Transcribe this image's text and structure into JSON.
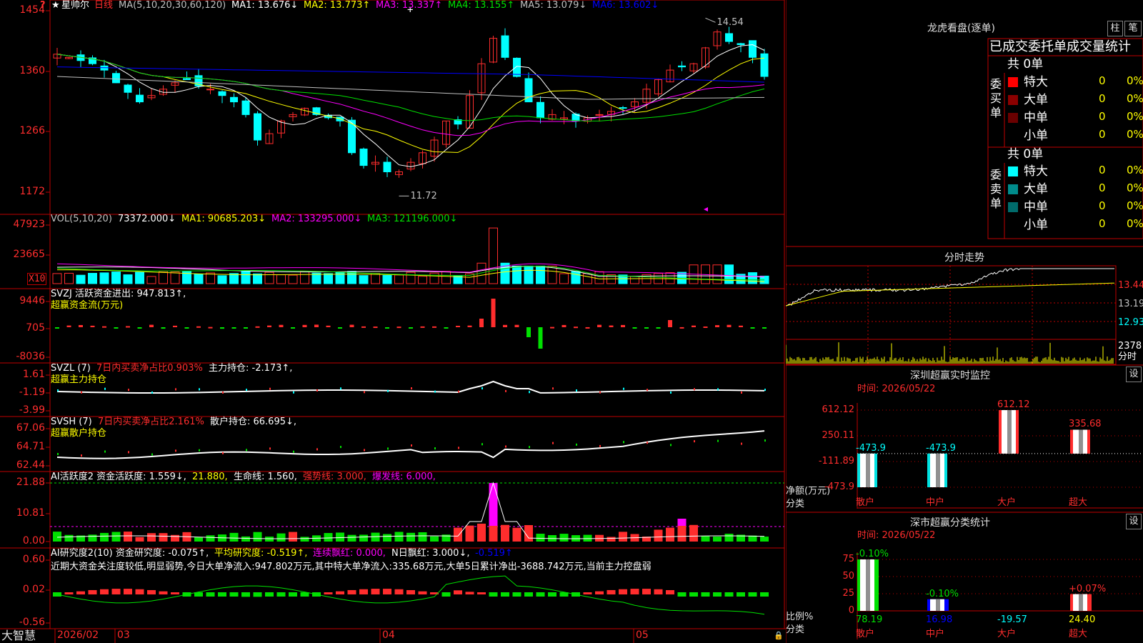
{
  "stock": {
    "name": "星帅尔",
    "period": "日线",
    "corner_mark": "?"
  },
  "colors": {
    "bg": "#000000",
    "frame": "#c00000",
    "up": "#ff2d2d",
    "down": "#00ffff",
    "ma1": "#ffffff",
    "ma2": "#ffff00",
    "ma3": "#ff00ff",
    "ma4": "#00e000",
    "ma5": "#c0c0c0",
    "ma6": "#0000ff",
    "green": "#00e000",
    "bright": "#ff0000"
  },
  "price_panel": {
    "legend": [
      {
        "text": "MA(5,10,20,30,60,120)",
        "color": "#c0c0c0"
      },
      {
        "text": "MA1: 13.676↓",
        "color": "#ffffff"
      },
      {
        "text": "MA2: 13.773↑",
        "color": "#ffff00"
      },
      {
        "text": "MA3: 13.337↑",
        "color": "#ff00ff"
      },
      {
        "text": "MA4: 13.155↑",
        "color": "#00e000"
      },
      {
        "text": "MA5: 13.079↓",
        "color": "#c0c0c0"
      },
      {
        "text": "MA6: 13.602↓",
        "color": "#0000ff"
      }
    ],
    "ticks": [
      "1454",
      "1360",
      "1266",
      "1172"
    ],
    "high_label": "14.54",
    "low_label": "11.72"
  },
  "vol_panel": {
    "legend": [
      {
        "text": "VOL(5,10,20)",
        "color": "#c0c0c0"
      },
      {
        "text": "73372.000↓",
        "color": "#ffffff"
      },
      {
        "text": "MA1: 90685.203↓",
        "color": "#ffff00"
      },
      {
        "text": "MA2: 133295.000↓",
        "color": "#ff00ff"
      },
      {
        "text": "MA3: 121196.000↓",
        "color": "#00e000"
      }
    ],
    "ticks": [
      "47923",
      "23665"
    ],
    "unit": "X10"
  },
  "svzj_panel": {
    "legend": [
      {
        "text": "SVZJ  活跃资金进出: 947.813↑,",
        "color": "#ffffff"
      }
    ],
    "subtitle": "超赢资金流(万元)",
    "ticks": [
      "9446",
      "705",
      "-8036"
    ]
  },
  "svzl_panel": {
    "legend": [
      {
        "text": "SVZL (7)",
        "color": "#ffffff"
      },
      {
        "text": "7日内买卖净占比0.903%",
        "color": "#ff2d2d"
      },
      {
        "text": "主力持仓: -2.173↑,",
        "color": "#ffffff"
      }
    ],
    "subtitle": "超赢主力持仓",
    "ticks": [
      "1.61",
      "-1.19",
      "-3.99"
    ]
  },
  "svsh_panel": {
    "legend": [
      {
        "text": "SVSH (7)",
        "color": "#ffffff"
      },
      {
        "text": "7日内买卖净占比2.161%",
        "color": "#ff2d2d"
      },
      {
        "text": "散户持仓: 66.695↓,",
        "color": "#ffffff"
      }
    ],
    "subtitle": "超赢散户持仓",
    "ticks": [
      "67.06",
      "64.71",
      "62.44"
    ]
  },
  "ai2_panel": {
    "legend": [
      {
        "text": "AI活跃度2 资金活跃度: 1.559↓,",
        "color": "#ffffff"
      },
      {
        "text": "21.880,",
        "color": "#ffff00"
      },
      {
        "text": "生命线: 1.560,",
        "color": "#ffffff"
      },
      {
        "text": "强势线: 3.000,",
        "color": "#ff2d2d"
      },
      {
        "text": "爆发线: 6.000,",
        "color": "#ff00ff"
      }
    ],
    "ticks": [
      "21.88",
      "10.81",
      "0.00"
    ]
  },
  "ai_research_panel": {
    "legend": [
      {
        "text": "AI研究度2(10) 资金研究度: -0.075↑,",
        "color": "#ffffff"
      },
      {
        "text": "平均研究度: -0.519↑,",
        "color": "#ffff00"
      },
      {
        "text": "连续飘红: 0.000,",
        "color": "#ff00ff"
      },
      {
        "text": "N日飘红: 3.000↓,",
        "color": "#ffffff"
      },
      {
        "text": "-0.519↑",
        "color": "#0000ff"
      }
    ],
    "comment": "近期大资金关注度较低,明显弱势,今日大单净流入:947.802万元,其中特大单净流入:335.68万元,大单5日累计净出-3688.742万元,当前主力控盘弱",
    "ticks": [
      "0.60",
      "0.02",
      "-0.56"
    ]
  },
  "time_axis": {
    "brand": "大智慧",
    "labels": [
      "2026/02",
      "03",
      "04",
      "05"
    ]
  },
  "right": {
    "dragon_title": "龙虎看盘(逐单)",
    "tab_zhu": "柱",
    "tab_bi": "笔",
    "order_stats_title": "已成交委托单成交量统计",
    "buy_side": {
      "label": "委买单",
      "total": "共 0单",
      "rows": [
        {
          "name": "特大",
          "count": "0",
          "pct": "0%",
          "color": "#ff0000"
        },
        {
          "name": "大单",
          "count": "0",
          "pct": "0%",
          "color": "#8b0000"
        },
        {
          "name": "中单",
          "count": "0",
          "pct": "0%",
          "color": "#6a0000"
        },
        {
          "name": "小单",
          "count": "0",
          "pct": "0%",
          "color": "#000000"
        }
      ]
    },
    "sell_side": {
      "label": "委卖单",
      "total": "共 0单",
      "rows": [
        {
          "name": "特大",
          "count": "0",
          "pct": "0%",
          "color": "#00ffff"
        },
        {
          "name": "大单",
          "count": "0",
          "pct": "0%",
          "color": "#008b8b"
        },
        {
          "name": "中单",
          "count": "0",
          "pct": "0%",
          "color": "#006b6b"
        },
        {
          "name": "小单",
          "count": "0",
          "pct": "0%",
          "color": "#000000"
        }
      ]
    },
    "intraday": {
      "title": "分时走势",
      "ticks": [
        "13.44",
        "13.19",
        "12.93"
      ],
      "vol_tick": "2378",
      "vol_label": "分时"
    },
    "sz_monitor": {
      "title": "深圳超赢实时监控",
      "set_label": "设",
      "time": "时间: 2026/05/22",
      "ylabel": "净额(万元)",
      "xlabel": "分类",
      "yticks": [
        "612.12",
        "250.11",
        "-111.89",
        "-473.9"
      ],
      "chart_data": {
        "type": "bar",
        "categories": [
          "散户",
          "中户",
          "大户",
          "超大"
        ],
        "values": [
          -473.9,
          -473.9,
          612.12,
          335.68
        ],
        "value_labels": [
          "-473.9",
          "-473.9",
          "612.12",
          "335.68"
        ],
        "ylim": [
          -473.9,
          612.12
        ],
        "ylabel": "净额(万元)",
        "xlabel": "分类"
      }
    },
    "sz_stats": {
      "title": "深市超赢分类统计",
      "set_label": "设",
      "time": "时间: 2026/05/22",
      "ylabel": "比例%",
      "xlabel": "分类",
      "yticks": [
        "75",
        "50",
        "25",
        "0"
      ],
      "chart_data": {
        "type": "bar",
        "categories": [
          "散户",
          "中户",
          "大户",
          "超大"
        ],
        "values": [
          78.19,
          16.98,
          -19.57,
          24.4
        ],
        "top_labels": [
          "-0.10%",
          "-0.10%",
          "",
          "+0.07%"
        ],
        "bottom_labels": [
          "78.19",
          "16.98",
          "-19.57",
          "24.40"
        ],
        "ylim": [
          0,
          75
        ],
        "ylabel": "比例%",
        "xlabel": "分类"
      }
    }
  }
}
